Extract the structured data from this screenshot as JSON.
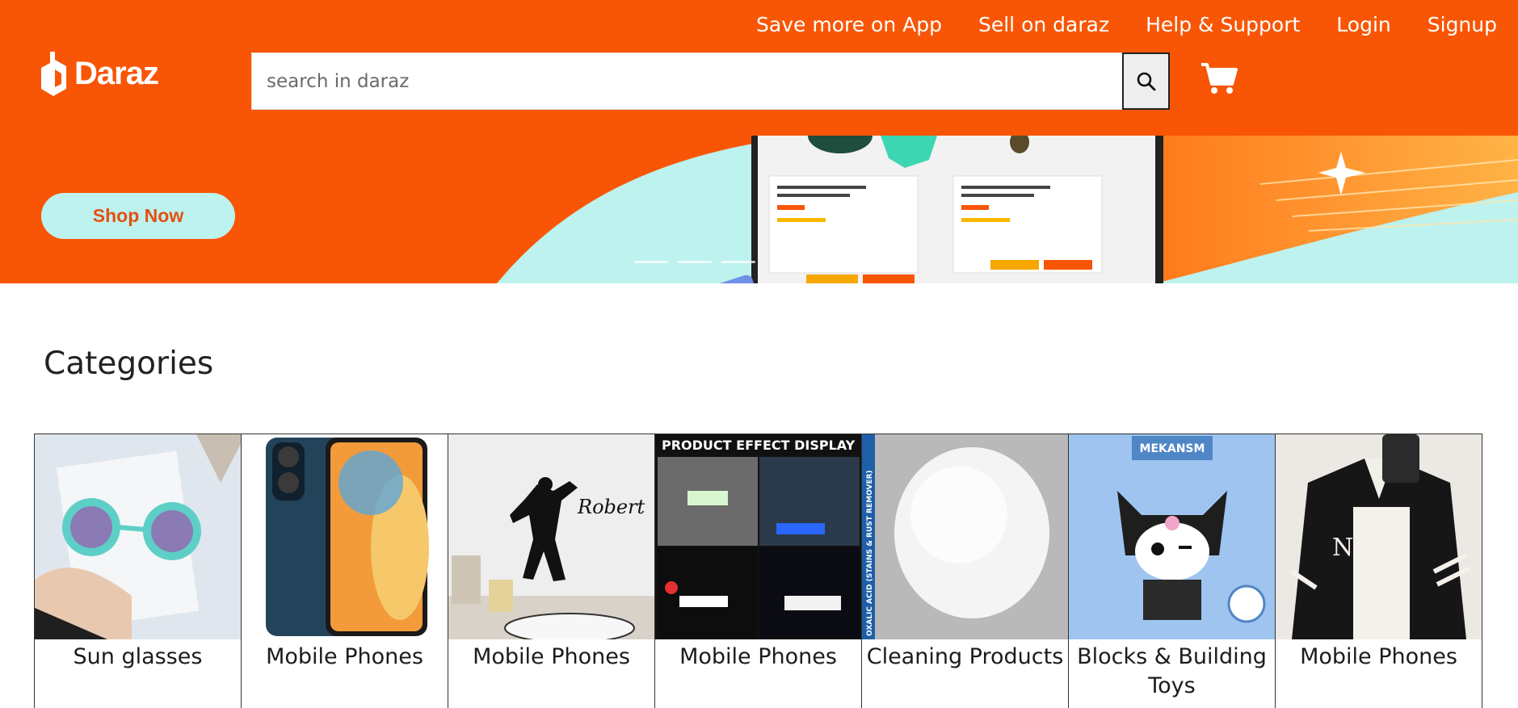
{
  "header": {
    "brand": "Daraz",
    "top_links": [
      "Save more on App",
      "Sell on daraz",
      "Help & Support",
      "Login",
      "Signup"
    ],
    "search_placeholder": "search in daraz"
  },
  "banner": {
    "cta_label": "Shop Now",
    "slide_count": 3
  },
  "categories": {
    "title": "Categories",
    "items": [
      {
        "label": "Sun glasses"
      },
      {
        "label": "Mobile Phones"
      },
      {
        "label": "Mobile Phones",
        "image_text": "Robert"
      },
      {
        "label": "Mobile Phones",
        "image_text": "PRODUCT EFFECT DISPLAY"
      },
      {
        "label": "Cleaning Products",
        "image_text": "OXALIC ACID (STAINS & RUST REMOVER)"
      },
      {
        "label": "Blocks & Building Toys",
        "image_text": "MEKANSM"
      },
      {
        "label": "Mobile Phones"
      }
    ]
  },
  "colors": {
    "brand_orange": "#f85606",
    "banner_mint": "#bdf2ee"
  }
}
